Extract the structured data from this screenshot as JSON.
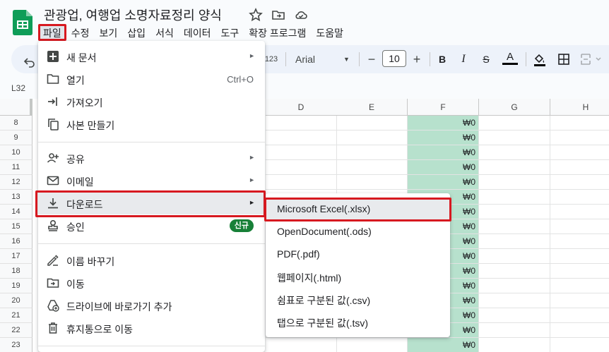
{
  "header": {
    "doc_title": "관광업, 여행업 소명자료정리 양식",
    "title_icons": [
      "star-icon",
      "move-folder-icon",
      "cloud-status-icon"
    ]
  },
  "menubar": {
    "items": [
      "파일",
      "수정",
      "보기",
      "삽입",
      "서식",
      "데이터",
      "도구",
      "확장 프로그램",
      "도움말"
    ]
  },
  "toolbar": {
    "undo_icon": "undo-icon",
    "number_format": "123",
    "font_name": "Arial",
    "font_size": "10",
    "minus": "−",
    "plus": "+",
    "bold": "B",
    "italic": "I",
    "strike": "S",
    "text_color": "A"
  },
  "namebox": {
    "ref": "L32"
  },
  "grid": {
    "columns": [
      "D",
      "E",
      "F",
      "G",
      "H"
    ],
    "rows": [
      "8",
      "9",
      "10",
      "11",
      "12",
      "13",
      "14",
      "15",
      "16",
      "17",
      "18",
      "19",
      "20",
      "21",
      "22",
      "23"
    ],
    "f_value": "₩0",
    "highlight_color": "#b7e1cd"
  },
  "file_menu": {
    "new": "새 문서",
    "open": "열기",
    "open_shortcut": "Ctrl+O",
    "import": "가져오기",
    "copy": "사본 만들기",
    "share": "공유",
    "email": "이메일",
    "download": "다운로드",
    "approval": "승인",
    "approval_badge": "신규",
    "rename": "이름 바꾸기",
    "move": "이동",
    "shortcut": "드라이브에 바로가기 추가",
    "trash": "휴지통으로 이동"
  },
  "download_menu": {
    "items": [
      "Microsoft Excel(.xlsx)",
      "OpenDocument(.ods)",
      "PDF(.pdf)",
      "웹페이지(.html)",
      "쉼표로 구분된 값(.csv)",
      "탭으로 구분된 값(.tsv)"
    ]
  },
  "colors": {
    "accent_red": "#d71920",
    "sheets_green": "#188038"
  }
}
